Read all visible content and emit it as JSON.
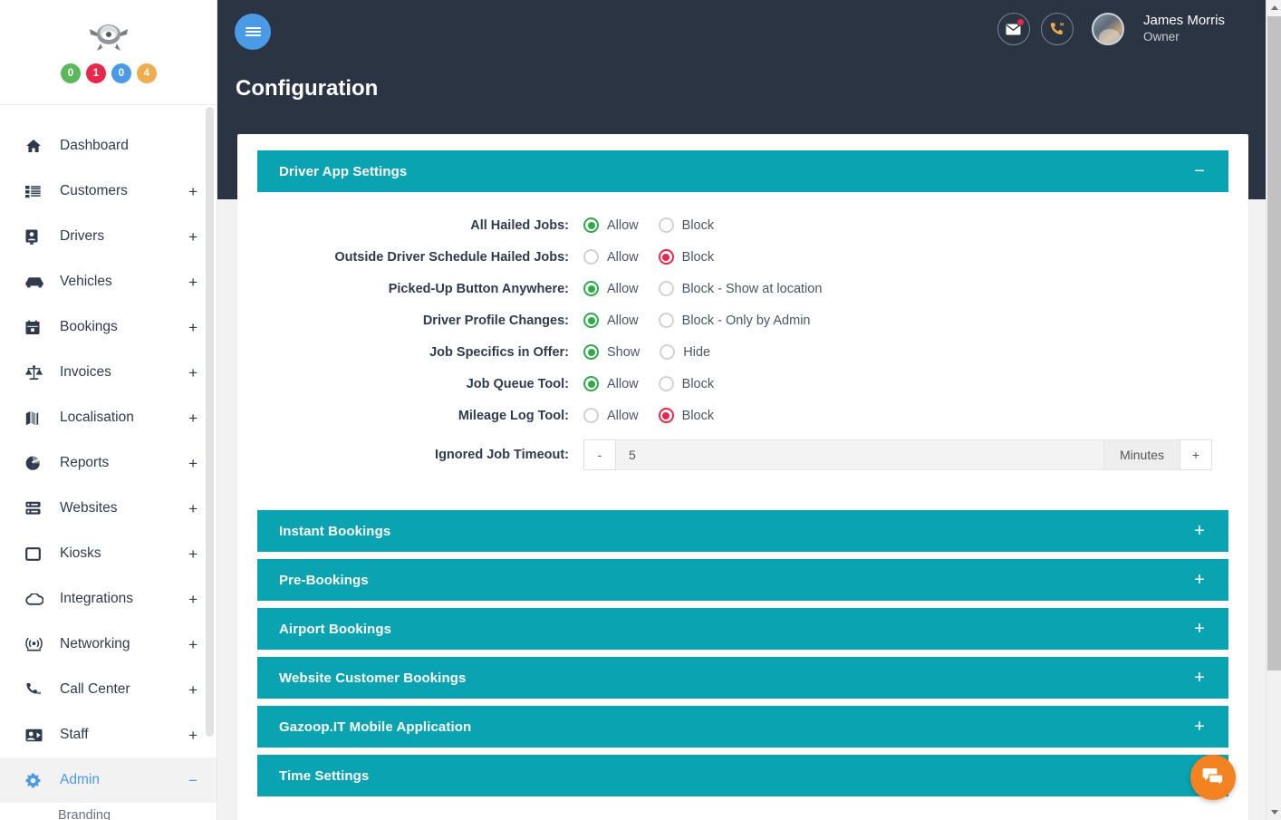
{
  "sidebar": {
    "logo_name": "gazoop-logo",
    "badges": [
      {
        "value": "0",
        "color": "#5cb85c"
      },
      {
        "value": "1",
        "color": "#e8284b"
      },
      {
        "value": "0",
        "color": "#4a9ae6"
      },
      {
        "value": "4",
        "color": "#f0ad4e"
      }
    ],
    "items": [
      {
        "label": "Dashboard",
        "icon": "home-icon",
        "expander": "",
        "active": false
      },
      {
        "label": "Customers",
        "icon": "list-icon",
        "expander": "+",
        "active": false
      },
      {
        "label": "Drivers",
        "icon": "id-card-icon",
        "expander": "+",
        "active": false
      },
      {
        "label": "Vehicles",
        "icon": "car-icon",
        "expander": "+",
        "active": false
      },
      {
        "label": "Bookings",
        "icon": "calendar-icon",
        "expander": "+",
        "active": false
      },
      {
        "label": "Invoices",
        "icon": "scales-icon",
        "expander": "+",
        "active": false
      },
      {
        "label": "Localisation",
        "icon": "map-icon",
        "expander": "+",
        "active": false
      },
      {
        "label": "Reports",
        "icon": "pie-chart-icon",
        "expander": "+",
        "active": false
      },
      {
        "label": "Websites",
        "icon": "server-icon",
        "expander": "+",
        "active": false
      },
      {
        "label": "Kiosks",
        "icon": "square-icon",
        "expander": "+",
        "active": false
      },
      {
        "label": "Integrations",
        "icon": "cloud-icon",
        "expander": "+",
        "active": false
      },
      {
        "label": "Networking",
        "icon": "broadcast-icon",
        "expander": "+",
        "active": false
      },
      {
        "label": "Call Center",
        "icon": "phone-icon",
        "expander": "+",
        "active": false
      },
      {
        "label": "Staff",
        "icon": "user-card-icon",
        "expander": "+",
        "active": false
      },
      {
        "label": "Admin",
        "icon": "gear-icon",
        "expander": "−",
        "active": true
      }
    ],
    "sub_item": "Branding"
  },
  "topbar": {
    "menu_icon": "hamburger-icon",
    "page_title": "Configuration",
    "mail_icon": "envelope-icon",
    "phone_icon": "phone-icon",
    "user_name": "James Morris",
    "user_role": "Owner"
  },
  "panels": [
    {
      "title": "Driver App Settings",
      "toggle": "−",
      "expanded": true
    },
    {
      "title": "Instant Bookings",
      "toggle": "+",
      "expanded": false
    },
    {
      "title": "Pre-Bookings",
      "toggle": "+",
      "expanded": false
    },
    {
      "title": "Airport Bookings",
      "toggle": "+",
      "expanded": false
    },
    {
      "title": "Website Customer Bookings",
      "toggle": "+",
      "expanded": false
    },
    {
      "title": "Gazoop.IT Mobile Application",
      "toggle": "+",
      "expanded": false
    },
    {
      "title": "Time Settings",
      "toggle": "+",
      "expanded": false
    }
  ],
  "form": {
    "rows": [
      {
        "label": "All Hailed Jobs:",
        "opt1": "Allow",
        "opt2": "Block",
        "selected": 1
      },
      {
        "label": "Outside Driver Schedule Hailed Jobs:",
        "opt1": "Allow",
        "opt2": "Block",
        "selected": 2
      },
      {
        "label": "Picked-Up Button Anywhere:",
        "opt1": "Allow",
        "opt2": "Block - Show at location",
        "selected": 1
      },
      {
        "label": "Driver Profile Changes:",
        "opt1": "Allow",
        "opt2": "Block - Only by Admin",
        "selected": 1
      },
      {
        "label": "Job Specifics in Offer:",
        "opt1": "Show",
        "opt2": "Hide",
        "selected": 1
      },
      {
        "label": "Job Queue Tool:",
        "opt1": "Allow",
        "opt2": "Block",
        "selected": 1
      },
      {
        "label": "Mileage Log Tool:",
        "opt1": "Allow",
        "opt2": "Block",
        "selected": 2
      }
    ],
    "timeout": {
      "label": "Ignored Job Timeout:",
      "decrement": "-",
      "value": "5",
      "unit": "Minutes",
      "increment": "+"
    }
  },
  "chat": {
    "icon": "chat-bubble-icon"
  },
  "colors": {
    "teal": "#0aa3b2",
    "dark": "#2b3442",
    "blue": "#4a9ae6",
    "green": "#2faa4b",
    "red": "#e8284b",
    "orange": "#f58220"
  }
}
